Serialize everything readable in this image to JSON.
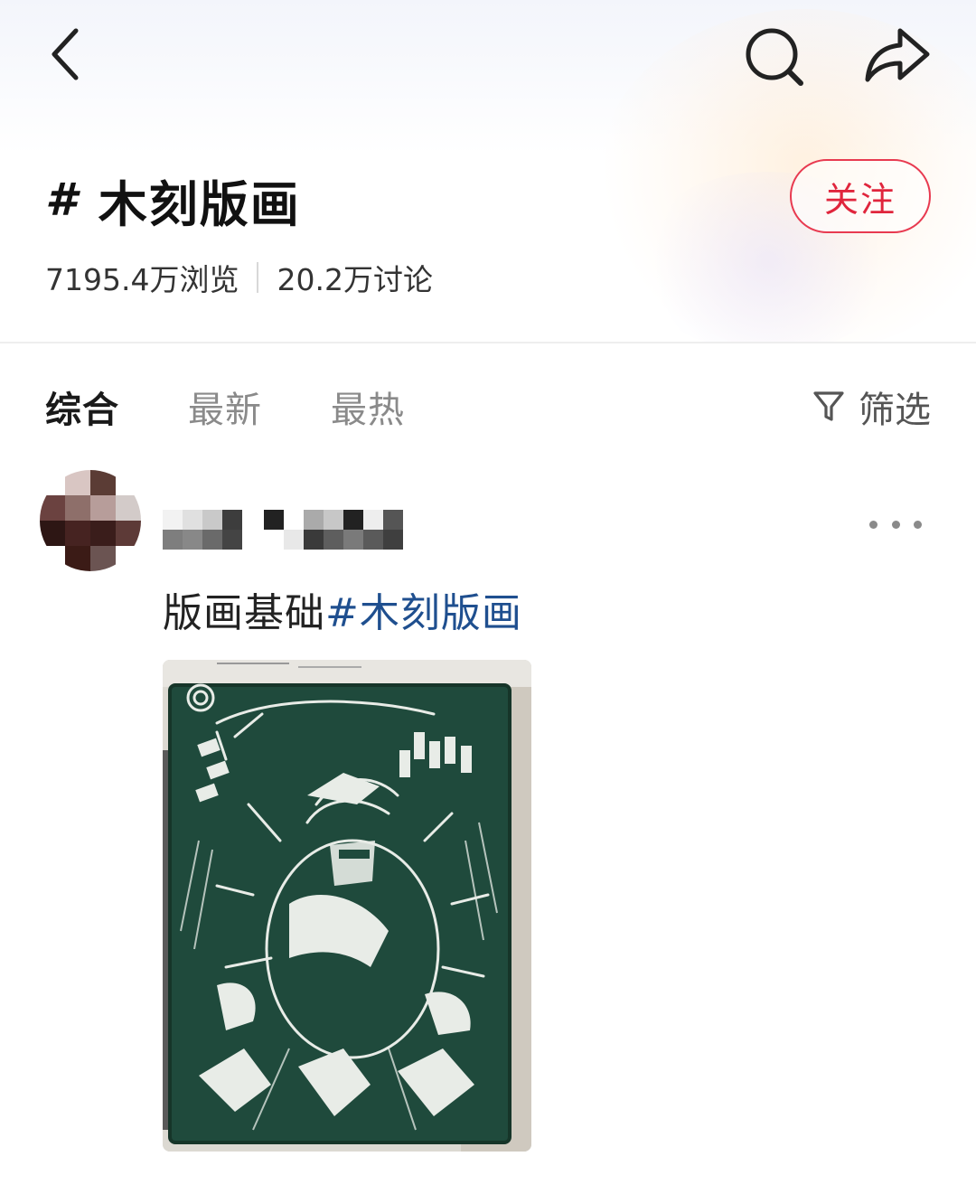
{
  "nav": {
    "back_icon": "chevron-left-icon",
    "search_icon": "search-icon",
    "share_icon": "share-arrow-icon"
  },
  "topic": {
    "hash": "#",
    "title": "木刻版画",
    "follow_label": "关注",
    "views": "7195.4万浏览",
    "discussions": "20.2万讨论"
  },
  "tabs": [
    {
      "label": "综合",
      "active": true
    },
    {
      "label": "最新",
      "active": false
    },
    {
      "label": "最热",
      "active": false
    }
  ],
  "filter": {
    "label": "筛选",
    "icon": "funnel-icon"
  },
  "post": {
    "text": "版画基础",
    "hashtag": "#木刻版画",
    "more_icon": "more-dots-icon",
    "image": "woodcut-print-photo"
  },
  "colors": {
    "accent_red": "#e0253c",
    "hashtag_blue": "#1f4f8f",
    "print_green": "#1f4a3c"
  }
}
